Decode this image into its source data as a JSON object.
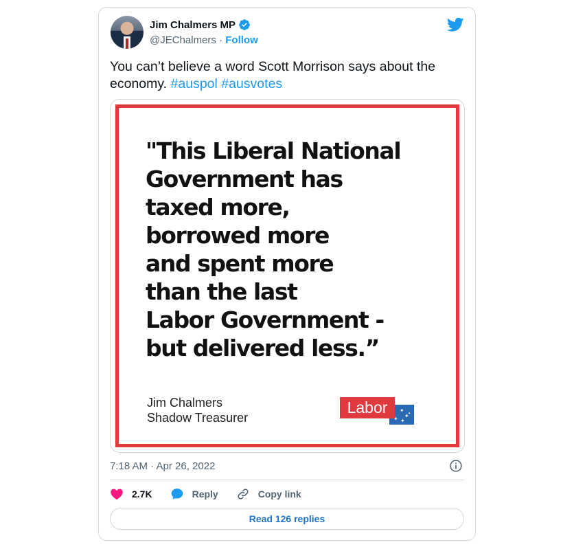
{
  "author": {
    "name": "Jim Chalmers MP",
    "handle": "@JEChalmers",
    "separator": "·",
    "follow_label": "Follow"
  },
  "tweet": {
    "text": "You can’t believe a word Scott Morrison says about the economy.",
    "hashtags": [
      "#auspol",
      "#ausvotes"
    ],
    "timestamp": "7:18 AM · Apr 26, 2022"
  },
  "media": {
    "quote_lines": [
      "\"This Liberal National",
      "Government has",
      "taxed more,",
      "borrowed more",
      "and spent more",
      "than the last",
      "Labor Government -",
      "but delivered less.”"
    ],
    "attribution_name": "Jim Chalmers",
    "attribution_title": "Shadow Treasurer",
    "logo_text": "Labor"
  },
  "actions": {
    "likes_count": "2.7K",
    "reply_label": "Reply",
    "copy_link_label": "Copy link"
  },
  "replies_button_label": "Read 126 replies",
  "colors": {
    "accent": "#1d9bf0",
    "like": "#f91880",
    "labor_red": "#e03a3f",
    "labor_blue": "#2a6ab3"
  },
  "icons": [
    "verified-badge-icon",
    "twitter-bird-icon",
    "info-icon",
    "heart-icon",
    "reply-bubble-icon",
    "link-icon"
  ]
}
